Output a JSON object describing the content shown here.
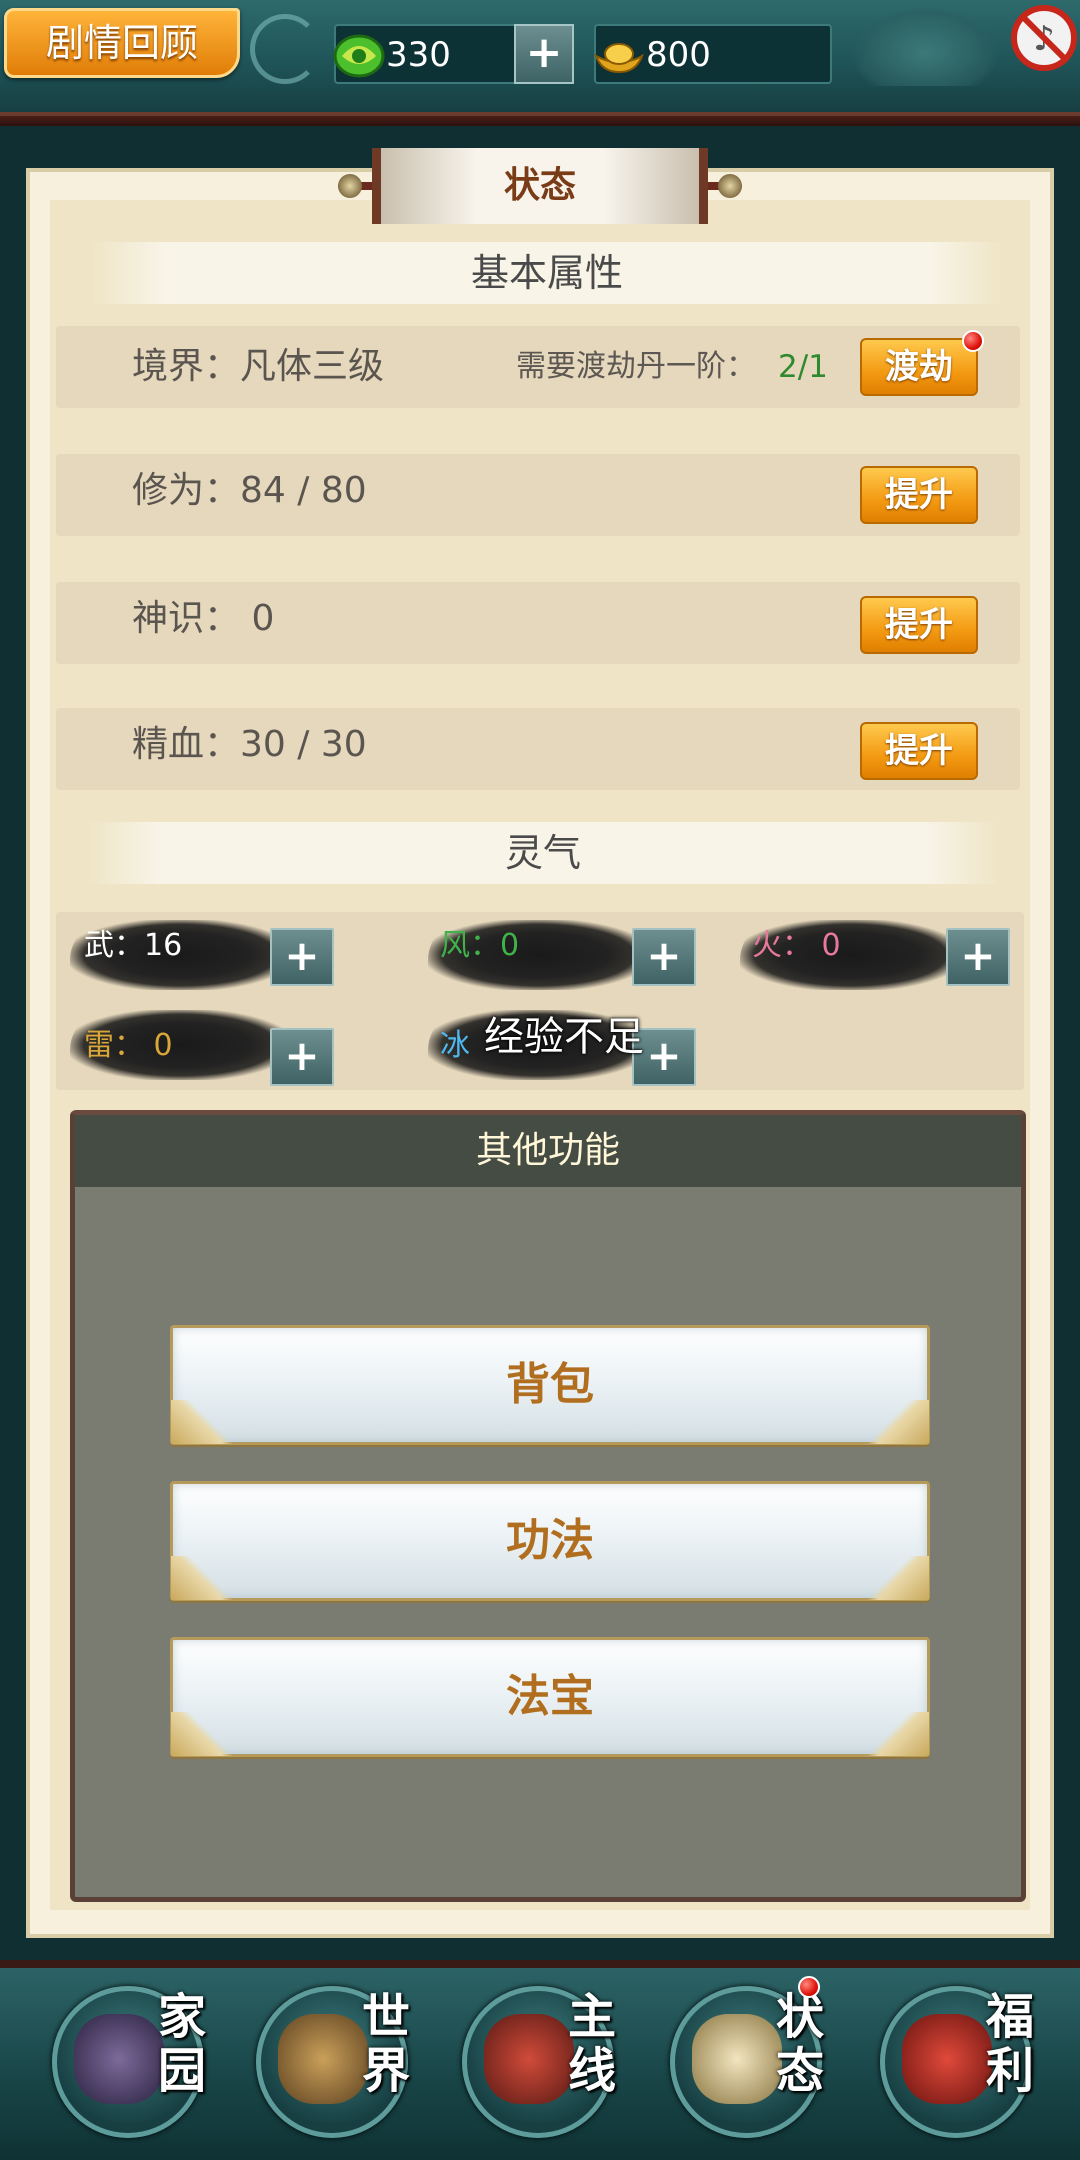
{
  "topbar": {
    "story_label": "剧情回顾",
    "jade_amount": "330",
    "gold_amount": "800",
    "plus_label": "+"
  },
  "panel": {
    "title": "状态",
    "basic_header": "基本属性",
    "realm": {
      "label": "境界：凡体三级",
      "need_label": "需要渡劫丹一阶：",
      "need_value": "2/1",
      "button": "渡劫"
    },
    "cultivation": {
      "label": "修为：84 / 80",
      "button": "提升"
    },
    "spirit": {
      "label": "神识： 0",
      "button": "提升"
    },
    "essence": {
      "label": "精血：30 / 30",
      "button": "提升"
    },
    "qi_header": "灵气",
    "qi": [
      {
        "name": "武",
        "value": "16",
        "color": "#ffffff"
      },
      {
        "name": "风",
        "value": "0",
        "color": "#3fb24a"
      },
      {
        "name": "火",
        "value": "0",
        "color": "#e8799c"
      },
      {
        "name": "雷",
        "value": "0",
        "color": "#d9a63a"
      },
      {
        "name": "冰",
        "value": "",
        "color": "#4fb8ef"
      }
    ],
    "tip": "经验不足"
  },
  "other": {
    "header": "其他功能",
    "buttons": [
      "背包",
      "功法",
      "法宝"
    ]
  },
  "nav": {
    "items": [
      {
        "label1": "家",
        "label2": "园",
        "icon": "home-icon"
      },
      {
        "label1": "世",
        "label2": "界",
        "icon": "world-icon"
      },
      {
        "label1": "主",
        "label2": "线",
        "icon": "mainline-icon"
      },
      {
        "label1": "状",
        "label2": "态",
        "icon": "status-icon"
      },
      {
        "label1": "福",
        "label2": "利",
        "icon": "welfare-icon"
      }
    ]
  },
  "colors": {
    "accent_orange": "#f39a12",
    "frame_teal": "#1f5558",
    "panel_bg": "#efe5c6",
    "green_value": "#2f8a2f"
  }
}
